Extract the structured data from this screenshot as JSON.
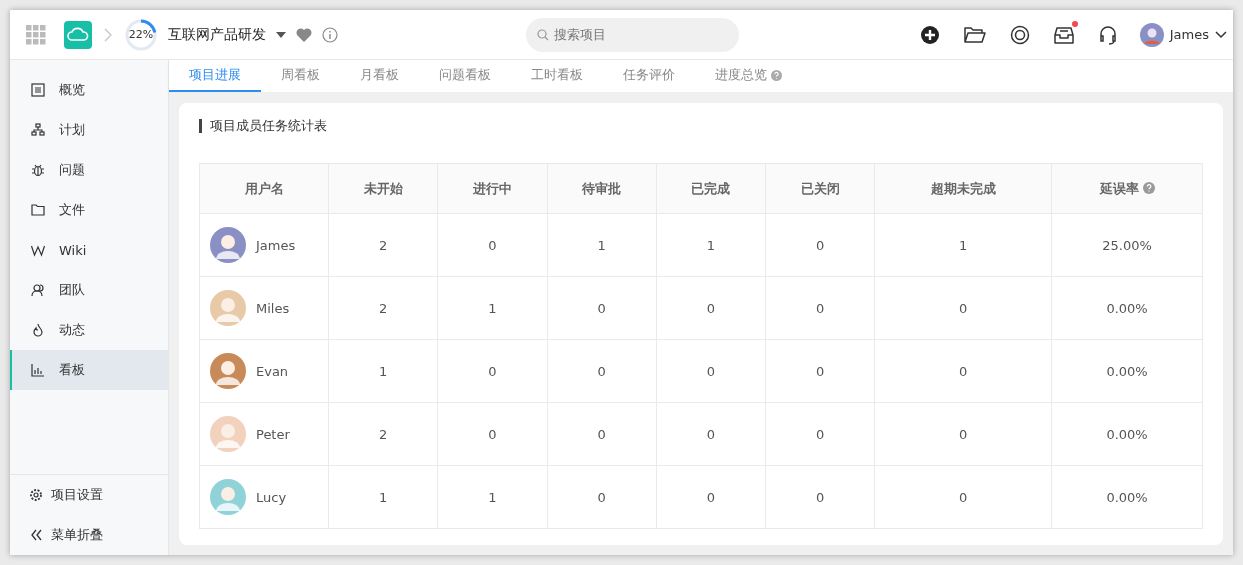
{
  "header": {
    "progress": {
      "level": 0.22,
      "label": "22%"
    },
    "project": "互联网产品研发",
    "search": {
      "placeholder": "搜索项目"
    },
    "notification": true,
    "user": "James"
  },
  "sidebar": {
    "items": [
      {
        "label": "概览",
        "selected": false
      },
      {
        "label": "计划",
        "selected": false
      },
      {
        "label": "问题",
        "selected": false
      },
      {
        "label": "文件",
        "selected": false
      },
      {
        "label": "Wiki",
        "selected": false
      },
      {
        "label": "团队",
        "selected": false
      },
      {
        "label": "动态",
        "selected": false
      },
      {
        "label": "看板",
        "selected": true
      }
    ],
    "footer": [
      "项目设置",
      "菜单折叠"
    ]
  },
  "tabs": [
    {
      "label": "项目进展",
      "selected": true,
      "help": false
    },
    {
      "label": "周看板",
      "selected": false,
      "help": false
    },
    {
      "label": "月看板",
      "selected": false,
      "help": false
    },
    {
      "label": "问题看板",
      "selected": false,
      "help": false
    },
    {
      "label": "工时看板",
      "selected": false,
      "help": false
    },
    {
      "label": "任务评价",
      "selected": false,
      "help": false
    },
    {
      "label": "进度总览",
      "selected": false,
      "help": true
    }
  ],
  "card_title": "项目成员任务统计表",
  "table": {
    "columns": [
      {
        "label": "用户名",
        "help": false
      },
      {
        "label": "未开始",
        "help": false
      },
      {
        "label": "进行中",
        "help": false
      },
      {
        "label": "待审批",
        "help": false
      },
      {
        "label": "已完成",
        "help": false
      },
      {
        "label": "已关闭",
        "help": false
      },
      {
        "label": "超期未完成",
        "help": false
      },
      {
        "label": "延误率",
        "help": true
      }
    ],
    "rows": [
      [
        "James",
        "2",
        "0",
        "1",
        "1",
        "0",
        "1",
        "25.00%"
      ],
      [
        "Miles",
        "2",
        "1",
        "0",
        "0",
        "0",
        "0",
        "0.00%"
      ],
      [
        "Evan",
        "1",
        "0",
        "0",
        "0",
        "0",
        "0",
        "0.00%"
      ],
      [
        "Peter",
        "2",
        "0",
        "0",
        "0",
        "0",
        "0",
        "0.00%"
      ],
      [
        "Lucy",
        "1",
        "1",
        "0",
        "0",
        "0",
        "0",
        "0.00%"
      ]
    ]
  }
}
